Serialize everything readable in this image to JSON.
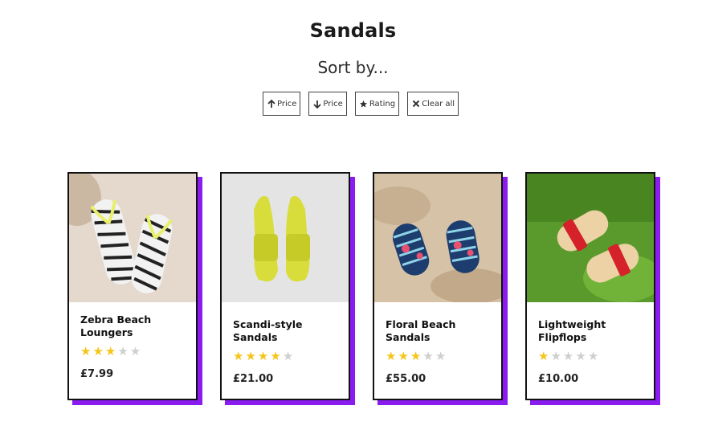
{
  "header": {
    "title": "Sandals",
    "subtitle": "Sort by..."
  },
  "sort": {
    "buttons": [
      {
        "label": "Price",
        "icon": "arrow-up-icon"
      },
      {
        "label": "Price",
        "icon": "arrow-down-icon"
      },
      {
        "label": "Rating",
        "icon": "star-icon"
      },
      {
        "label": "Clear all",
        "icon": "close-icon"
      }
    ]
  },
  "colors": {
    "accent_shadow": "#8a1cf0",
    "star_filled": "#f5c518",
    "star_empty": "#cfcfcf"
  },
  "products": [
    {
      "name": "Zebra Beach Loungers",
      "rating": 3,
      "max_rating": 5,
      "price": "£7.99",
      "image": "zebra-flipflops-photo"
    },
    {
      "name": "Scandi-style Sandals",
      "rating": 4,
      "max_rating": 5,
      "price": "£21.00",
      "image": "yellow-sandals-photo"
    },
    {
      "name": "Floral Beach Sandals",
      "rating": 3,
      "max_rating": 5,
      "price": "£55.00",
      "image": "floral-flipflops-photo"
    },
    {
      "name": "Lightweight Flipflops",
      "rating": 1,
      "max_rating": 5,
      "price": "£10.00",
      "image": "red-sandals-photo"
    }
  ]
}
